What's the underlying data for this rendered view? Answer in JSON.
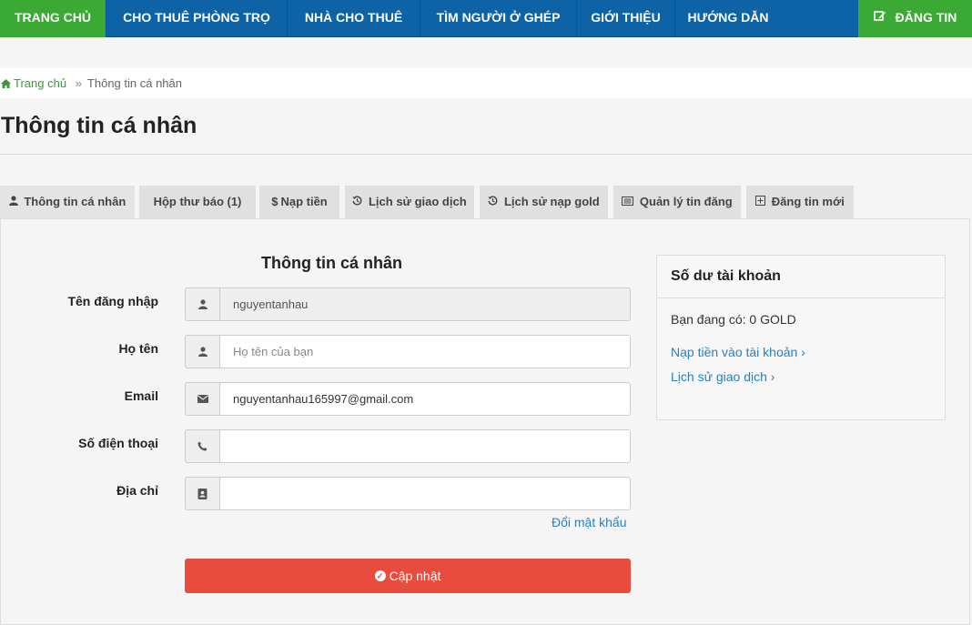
{
  "nav": {
    "home": "TRANG CHỦ",
    "rooms": "CHO THUÊ PHÒNG TRỌ",
    "houses": "NHÀ CHO THUÊ",
    "roommates": "TÌM NGƯỜI Ở GHÉP",
    "about": "GIỚI THIỆU",
    "guide": "HƯỚNG DẪN",
    "post": "ĐĂNG TIN"
  },
  "breadcrumb": {
    "home": "Trang chủ",
    "separator": "»",
    "current": "Thông tin cá nhân"
  },
  "page_title": "Thông tin cá nhân",
  "tabs": [
    {
      "icon": "user-icon",
      "label": "Thông tin cá nhân"
    },
    {
      "icon": "",
      "label": "Hộp thư báo (1)"
    },
    {
      "icon": "dollar-icon",
      "label": "Nạp tiền"
    },
    {
      "icon": "history-icon",
      "label": "Lịch sử giao dịch"
    },
    {
      "icon": "history-icon",
      "label": "Lịch sử nạp gold"
    },
    {
      "icon": "list-icon",
      "label": "Quản lý tin đăng"
    },
    {
      "icon": "plus-square-icon",
      "label": "Đăng tin mới"
    }
  ],
  "form": {
    "title": "Thông tin cá nhân",
    "username": {
      "label": "Tên đăng nhập",
      "value": "nguyentanhau",
      "icon": "user-icon"
    },
    "fullname": {
      "label": "Họ tên",
      "value": "",
      "placeholder": "Họ tên của bạn",
      "icon": "user-icon"
    },
    "email": {
      "label": "Email",
      "value": "nguyentanhau165997@gmail.com",
      "icon": "envelope-icon"
    },
    "phone": {
      "label": "Số điện thoại",
      "value": "",
      "icon": "phone-icon"
    },
    "address": {
      "label": "Địa chỉ",
      "value": "",
      "icon": "address-book-icon"
    },
    "change_password": "Đổi mật khẩu",
    "submit": "Cập nhật"
  },
  "balance": {
    "title": "Số dư tài khoản",
    "have": "Bạn đang có: 0 GOLD",
    "topup_link": "Nạp tiền vào tài khoản ›",
    "history_link": "Lịch sử giao dịch ›"
  },
  "colors": {
    "nav_blue": "#0d63a5",
    "green": "#3aaa35",
    "link": "#2a7fc1",
    "red": "#e84c3d"
  }
}
